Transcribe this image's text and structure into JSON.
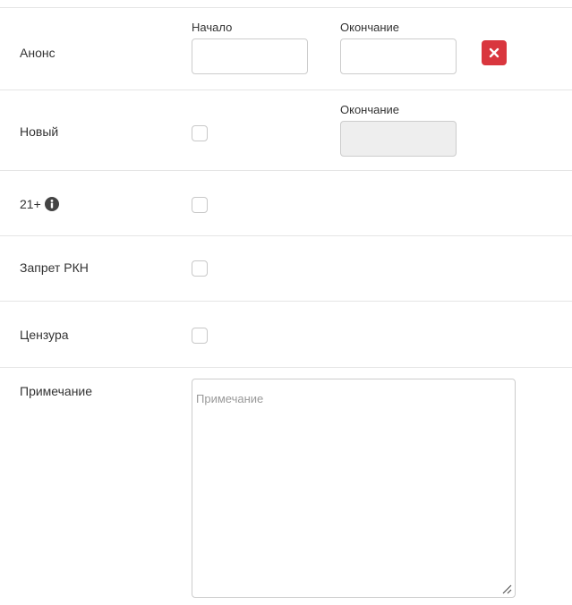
{
  "announce": {
    "label": "Анонс",
    "start_caption": "Начало",
    "end_caption": "Окончание",
    "start_value": "",
    "end_value": ""
  },
  "new": {
    "label": "Новый",
    "end_caption": "Окончание",
    "checked": false,
    "end_value": ""
  },
  "age21": {
    "label": "21+",
    "checked": false
  },
  "rkn_ban": {
    "label": "Запрет РКН",
    "checked": false
  },
  "censorship": {
    "label": "Цензура",
    "checked": false
  },
  "note": {
    "label": "Примечание",
    "placeholder": "Примечание",
    "value": ""
  },
  "colors": {
    "danger": "#d9363e",
    "border": "#cccccc",
    "divider": "#e5e5e5"
  }
}
